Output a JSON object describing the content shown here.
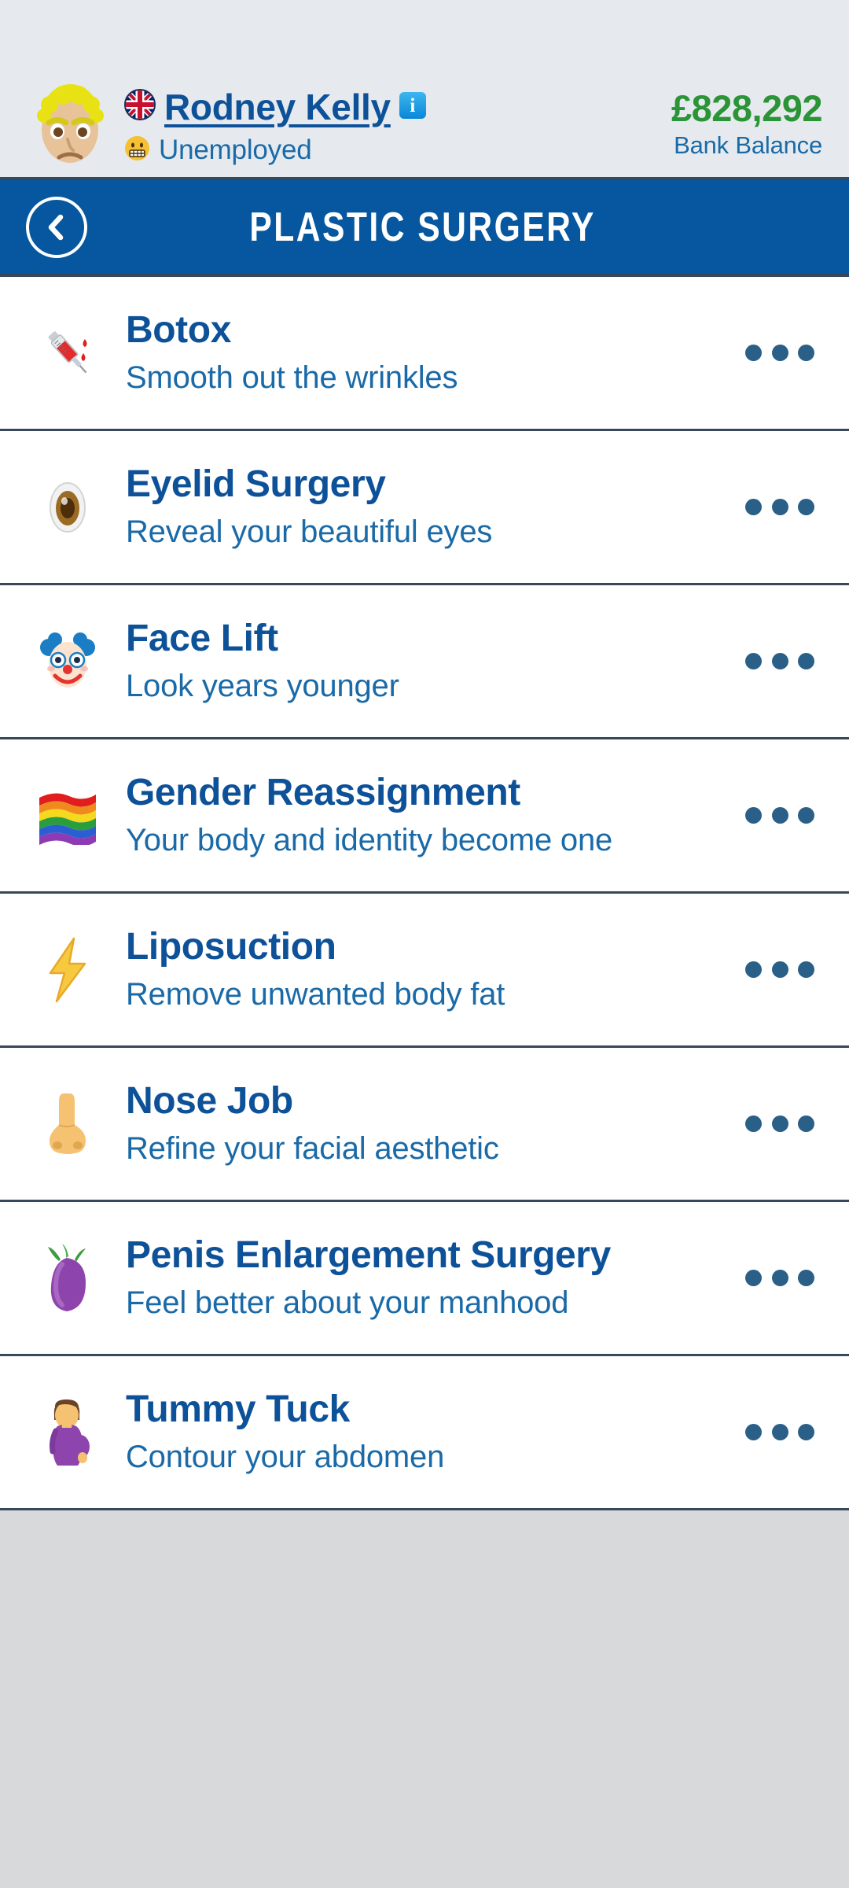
{
  "theme": {
    "statusbar_bg": "#e6eaee",
    "header_blue": "#06579f",
    "divider": "#37475c",
    "title_blue": "#0d5199",
    "subtitle_blue": "#1a6aa8",
    "money_green": "#2a9437",
    "dots_blue": "#2a5f87",
    "page_bg": "#d8d9db"
  },
  "profile": {
    "avatar_icon": "blond-man-frowning-avatar",
    "avatar_glyph": "🙍",
    "flag_icon": "united-kingdom-flag-icon",
    "flag_glyph": "🇬🇧",
    "name": "Rodney Kelly",
    "info_badge": "i",
    "mood_icon": "grimacing-face-icon",
    "mood_glyph": "😬",
    "job_status": "Unemployed",
    "bank_balance": "£828,292",
    "bank_balance_label": "Bank Balance"
  },
  "header": {
    "back_icon": "chevron-left-icon",
    "title": "PLASTIC SURGERY"
  },
  "menu_icon": "overflow-menu-icon",
  "list": {
    "items": [
      {
        "icon": "syringe-icon",
        "glyph": "💉",
        "title": "Botox",
        "subtitle": "Smooth out the wrinkles"
      },
      {
        "icon": "eye-icon",
        "glyph": "👁",
        "title": "Eyelid Surgery",
        "subtitle": "Reveal your beautiful eyes"
      },
      {
        "icon": "clown-face-icon",
        "glyph": "🤡",
        "title": "Face Lift",
        "subtitle": "Look years younger"
      },
      {
        "icon": "rainbow-flag-icon",
        "glyph": "🏳️‍🌈",
        "title": "Gender Reassignment",
        "subtitle": "Your body and identity become one"
      },
      {
        "icon": "high-voltage-icon",
        "glyph": "⚡",
        "title": "Liposuction",
        "subtitle": "Remove unwanted body fat"
      },
      {
        "icon": "nose-icon",
        "glyph": "👃",
        "title": "Nose Job",
        "subtitle": "Refine your facial aesthetic"
      },
      {
        "icon": "eggplant-icon",
        "glyph": "🍆",
        "title": "Penis Enlargement Surgery",
        "subtitle": "Feel better about your manhood"
      },
      {
        "icon": "pregnant-woman-icon",
        "glyph": "🤰",
        "title": "Tummy Tuck",
        "subtitle": "Contour your abdomen"
      }
    ]
  }
}
